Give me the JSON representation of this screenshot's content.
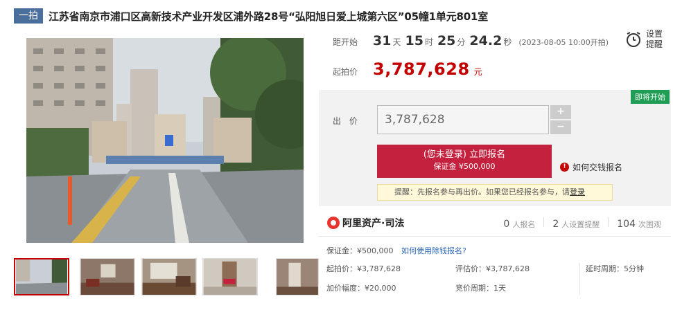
{
  "title": {
    "tag": "一拍",
    "text": "江苏省南京市浦口区高新技术产业开发区浦外路28号“弘阳旭日爱上城第六区”05幢1单元801室"
  },
  "countdown": {
    "label": "距开始",
    "days": "31",
    "days_unit": "天",
    "hours": "15",
    "hours_unit": "时",
    "minutes": "25",
    "minutes_unit": "分",
    "seconds": "24.2",
    "seconds_unit": "秒",
    "note": "(2023-08-05 10:00开拍)"
  },
  "reminder": {
    "label": "设置提醒",
    "icon": "alarm-clock-icon"
  },
  "starting_price": {
    "label": "起拍价",
    "value": "3,787,628",
    "unit": "元"
  },
  "bid": {
    "badge": "即将开始",
    "label": "出 价",
    "value": "3,787,628",
    "plus": "+",
    "minus": "−",
    "signup_main": "(您未登录) 立即报名",
    "signup_sub": "保证金 ¥500,000",
    "deposit_help": "如何交钱报名",
    "tip_prefix": "提醒：先报名参与再出价。如果您已经报名参与，请",
    "tip_link": "登录"
  },
  "brand": {
    "name": "阿里资产·司法"
  },
  "stats": [
    {
      "num": "0",
      "label": "人报名"
    },
    {
      "num": "2",
      "label": "人设置提醒"
    },
    {
      "num": "104",
      "label": "次围观"
    }
  ],
  "deposit": {
    "text": "保证金：¥500,000",
    "help": "如何使用除钱报名?"
  },
  "terms": {
    "start_price": "起拍价：¥3,787,628",
    "increment": "加价幅度：¥20,000",
    "appraisal": "评估价：¥3,787,628",
    "cycle": "竞价周期：1天",
    "delay": "延时周期：5分钟"
  },
  "colors": {
    "accent": "#c40000",
    "button": "#c4213e",
    "tag": "#4a6f9c",
    "badge": "#1f9d54"
  }
}
